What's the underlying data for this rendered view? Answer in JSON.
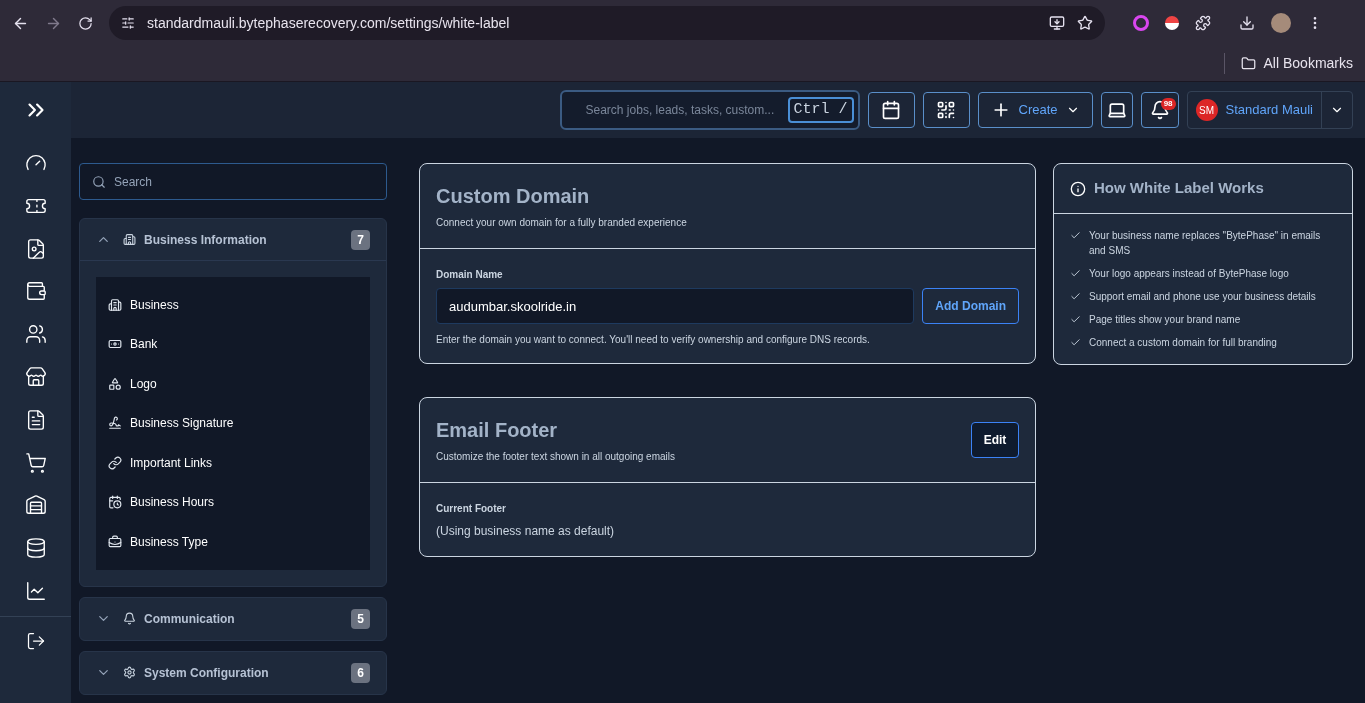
{
  "browser": {
    "url": "standardmauli.bytephaserecovery.com/settings/white-label",
    "bookmarks_label": "All Bookmarks"
  },
  "header": {
    "search_placeholder": "Search jobs, leads, tasks, custom...",
    "shortcut": "Ctrl /",
    "create_label": "Create",
    "notification_count": "98",
    "user_initials": "SM",
    "user_name": "Standard Mauli"
  },
  "settings_nav": {
    "search_placeholder": "Search",
    "groups": [
      {
        "label": "Business Information",
        "count": "7",
        "expanded": true,
        "items": [
          {
            "label": "Business"
          },
          {
            "label": "Bank"
          },
          {
            "label": "Logo"
          },
          {
            "label": "Business Signature"
          },
          {
            "label": "Important Links"
          },
          {
            "label": "Business Hours"
          },
          {
            "label": "Business Type"
          }
        ]
      },
      {
        "label": "Communication",
        "count": "5",
        "expanded": false
      },
      {
        "label": "System Configuration",
        "count": "6",
        "expanded": false
      }
    ]
  },
  "custom_domain": {
    "title": "Custom Domain",
    "subtitle": "Connect your own domain for a fully branded experience",
    "field_label": "Domain Name",
    "value": "audumbar.skoolride.in",
    "button": "Add Domain",
    "help": "Enter the domain you want to connect. You'll need to verify ownership and configure DNS records."
  },
  "email_footer": {
    "title": "Email Footer",
    "subtitle": "Customize the footer text shown in all outgoing emails",
    "button": "Edit",
    "field_label": "Current Footer",
    "value": "(Using business name as default)"
  },
  "how_it_works": {
    "title": "How White Label Works",
    "items": [
      "Your business name replaces \"BytePhase\" in emails and SMS",
      "Your logo appears instead of BytePhase logo",
      "Support email and phone use your business details",
      "Page titles show your brand name",
      "Connect a custom domain for full branding"
    ]
  }
}
